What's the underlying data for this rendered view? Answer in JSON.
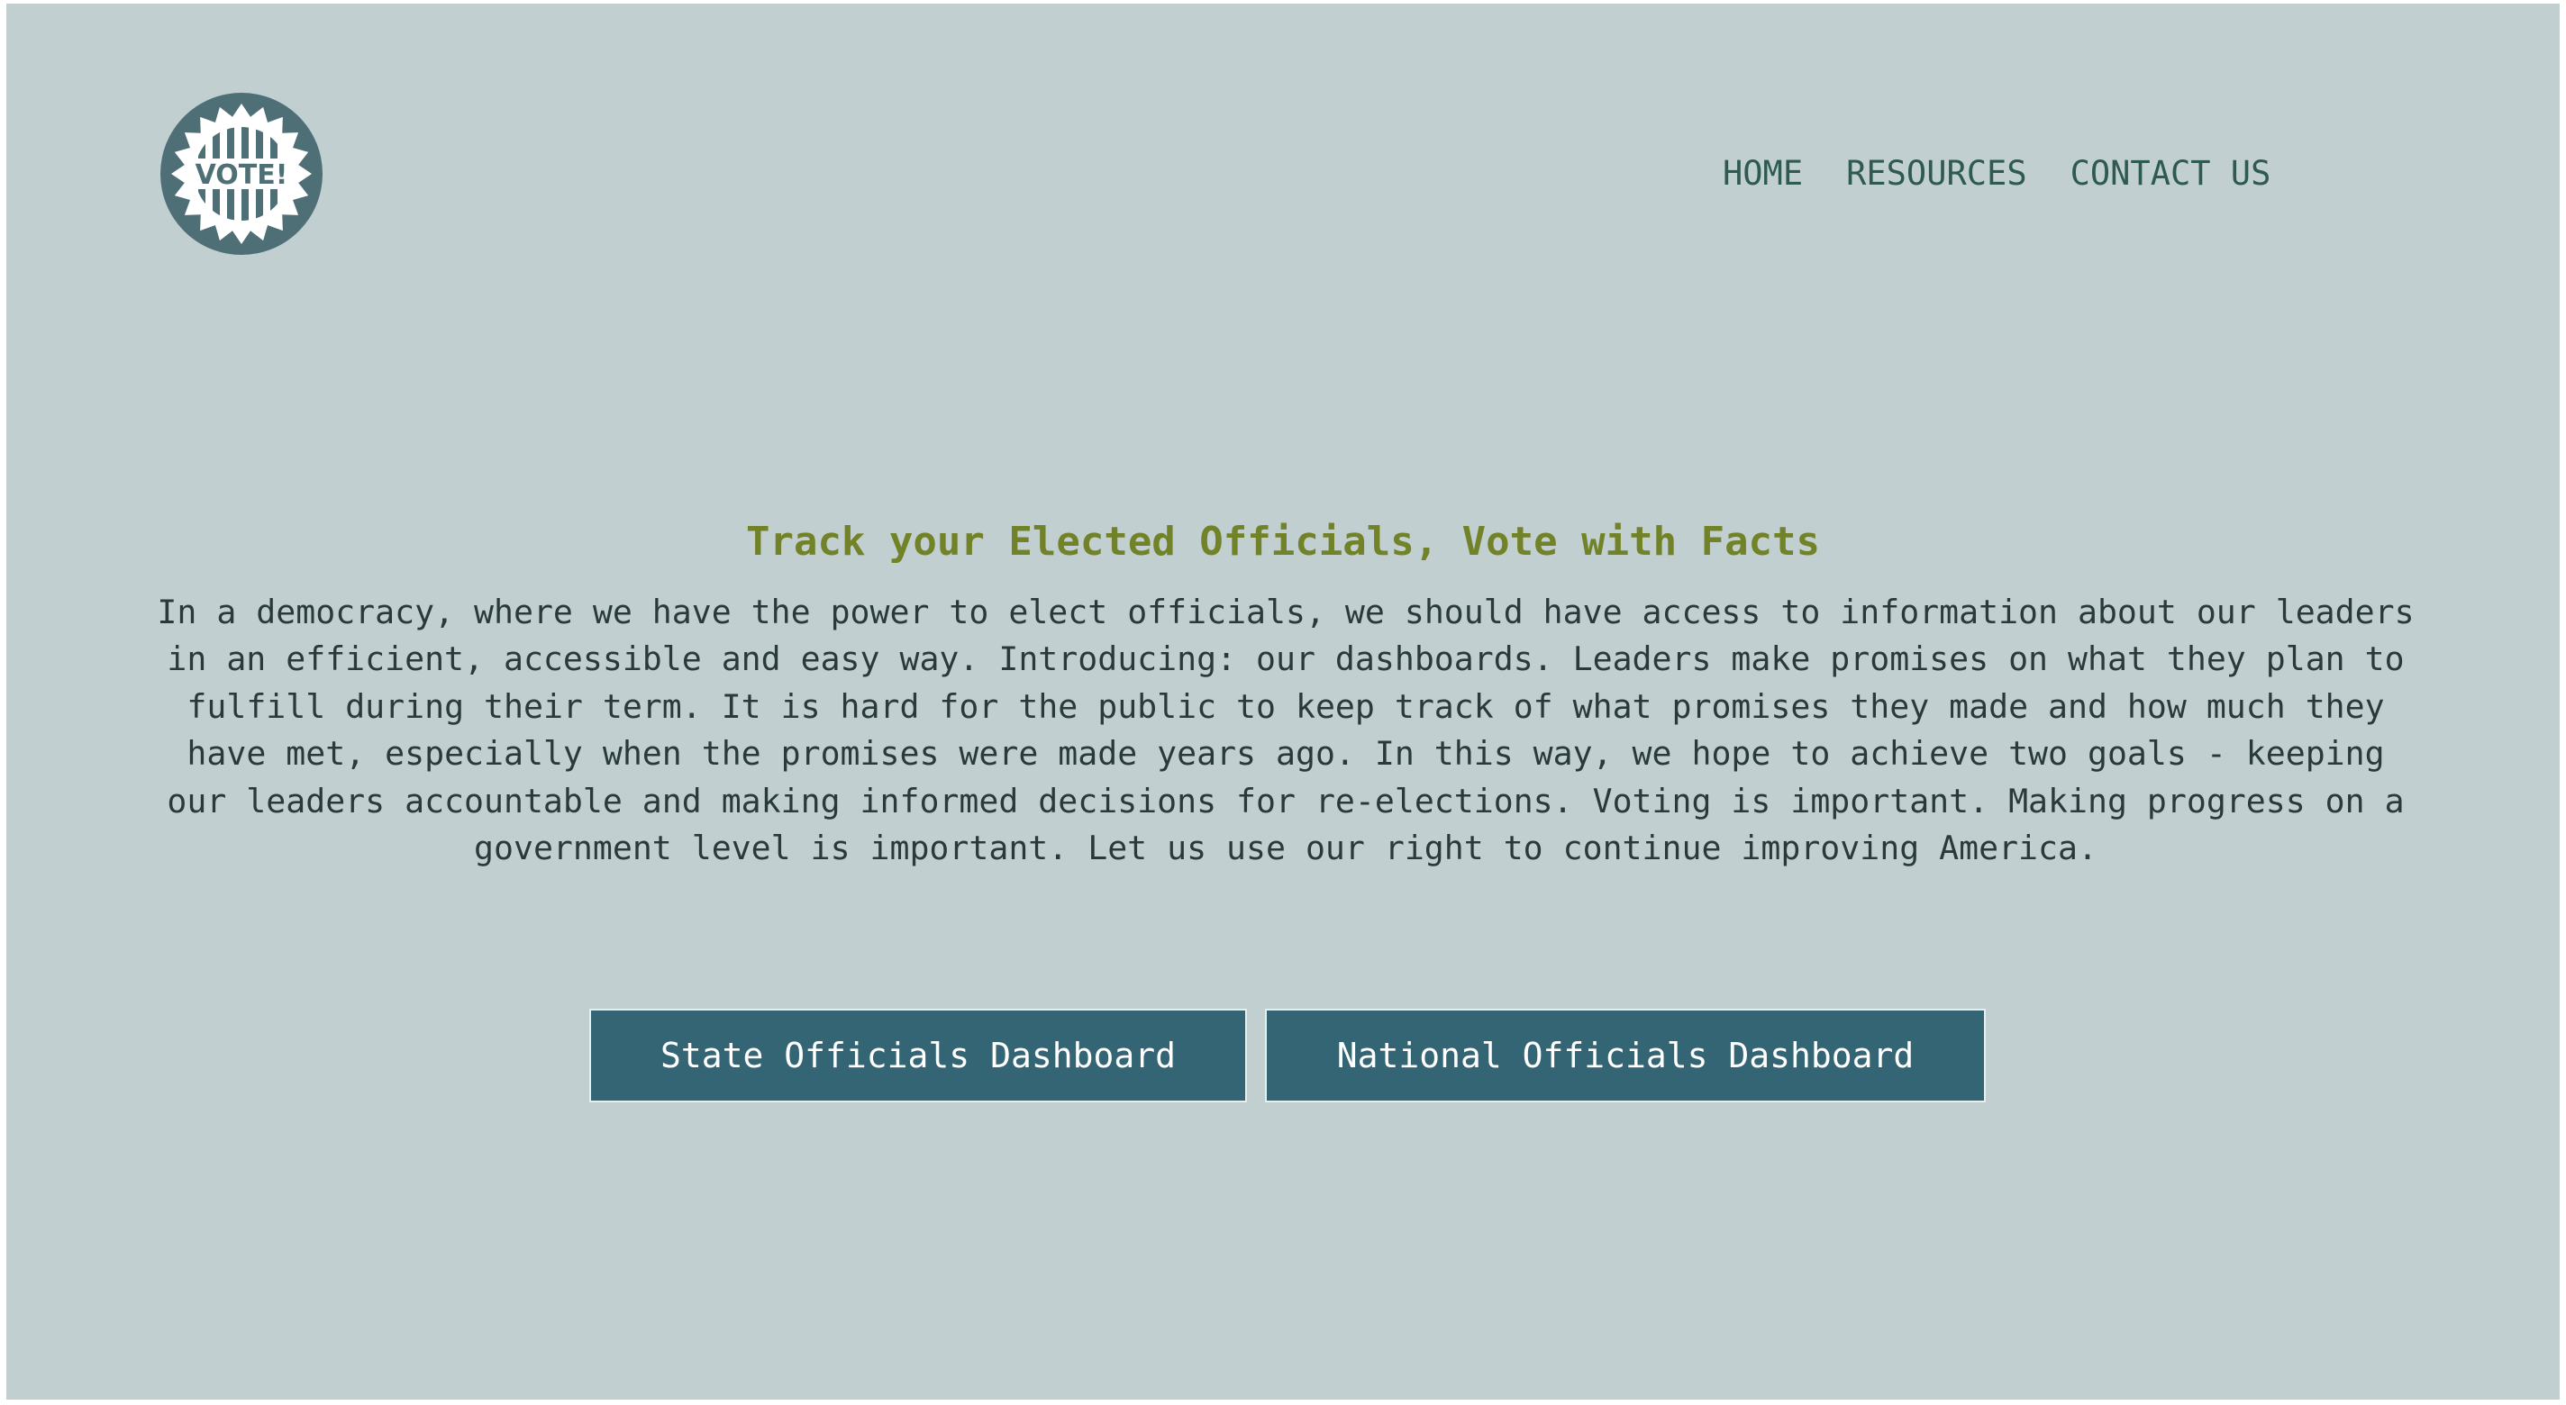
{
  "logo": {
    "text": "VOTE!",
    "icon": "vote-badge-icon"
  },
  "nav": {
    "items": [
      {
        "label": "HOME"
      },
      {
        "label": "RESOURCES"
      },
      {
        "label": "CONTACT US"
      }
    ]
  },
  "hero": {
    "title": "Track your Elected Officials, Vote with Facts",
    "body": "In a democracy, where we have the power to elect officials, we should have access to information about our leaders in an efficient, accessible and easy way. Introducing: our dashboards. Leaders make promises on what they plan to fulfill during their term. It is hard for the public to keep track of what promises they made and how much they have met, especially when the promises were made years ago. In this way, we hope to achieve two goals - keeping our leaders accountable and making informed decisions for re-elections. Voting is important. Making progress on a government level is important. Let us use our right to continue improving America."
  },
  "buttons": {
    "state_label": "State Officials Dashboard",
    "national_label": "National Officials Dashboard"
  },
  "colors": {
    "background": "#c1cfd0",
    "accent_title": "#728228",
    "nav_text": "#2e5a52",
    "button_bg": "#346574",
    "logo_circle": "#4f6f77"
  }
}
